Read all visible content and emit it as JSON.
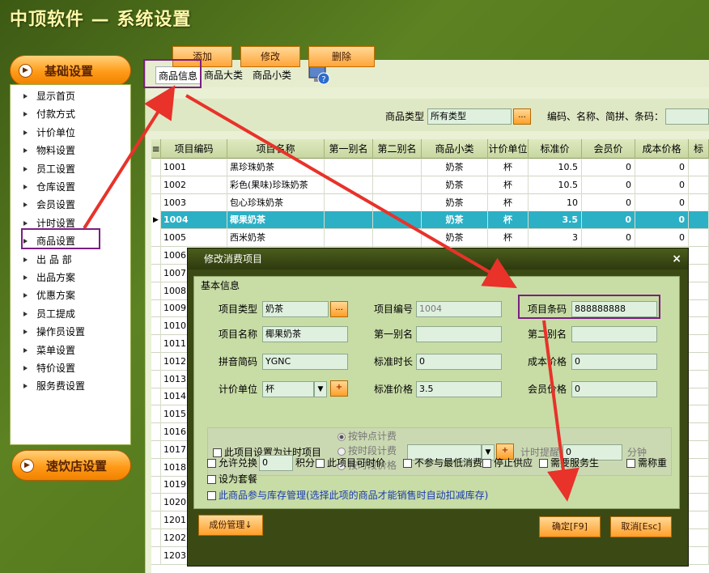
{
  "window": {
    "title": "中顶软件 — 系统设置"
  },
  "sidebar": {
    "basic_label": "基础设置",
    "fastfood_label": "速饮店设置",
    "items": [
      "显示首页",
      "付款方式",
      "计价单位",
      "物料设置",
      "员工设置",
      "仓库设置",
      "会员设置",
      "计时设置",
      "商品设置",
      "出 品 部",
      "出品方案",
      "优惠方案",
      "员工提成",
      "操作员设置",
      "菜单设置",
      "特价设置",
      "服务费设置"
    ]
  },
  "tabs": {
    "items": [
      "商品信息",
      "商品大类",
      "商品小类"
    ],
    "help_icon": "help-monitor-icon"
  },
  "toolbar": {
    "add": "添加",
    "edit": "修改",
    "delete": "删除",
    "type_label": "商品类型",
    "type_value": "所有类型",
    "dots": "...",
    "search_label": "编码、名称、简拼、条码："
  },
  "table": {
    "columns": [
      "项目编码",
      "项目名称",
      "第一别名",
      "第二别名",
      "商品小类",
      "计价单位",
      "标准价",
      "会员价",
      "成本价格",
      "标"
    ],
    "rows": [
      [
        "1001",
        "黑珍珠奶茶",
        "",
        "",
        "奶茶",
        "杯",
        "10.5",
        "0",
        "0"
      ],
      [
        "1002",
        "彩色(果味)珍珠奶茶",
        "",
        "",
        "奶茶",
        "杯",
        "10.5",
        "0",
        "0"
      ],
      [
        "1003",
        "包心珍珠奶茶",
        "",
        "",
        "奶茶",
        "杯",
        "10",
        "0",
        "0"
      ],
      [
        "1004",
        "椰果奶茶",
        "",
        "",
        "奶茶",
        "杯",
        "3.5",
        "0",
        "0"
      ],
      [
        "1005",
        "西米奶茶",
        "",
        "",
        "奶茶",
        "杯",
        "3",
        "0",
        "0"
      ]
    ],
    "extra_codes": [
      "1006",
      "1007",
      "1008",
      "1009",
      "1010",
      "1011",
      "1012",
      "1013",
      "1014",
      "1015",
      "1016",
      "1017",
      "1018",
      "1019",
      "1020",
      "1201",
      "1202",
      "1203"
    ],
    "selected_index": 3
  },
  "dialog": {
    "title": "修改消费项目",
    "close": "×",
    "group_title": "基本信息",
    "labels": {
      "type": "项目类型",
      "code": "项目编号",
      "barcode": "项目条码",
      "name": "项目名称",
      "alias1": "第一别名",
      "alias2": "第二别名",
      "pinyin": "拼音简码",
      "std_time": "标准时长",
      "cost": "成本价格",
      "unit": "计价单位",
      "std_price": "标准价格",
      "member_price": "会员价格",
      "timed_item": "此项目设置为计时项目",
      "by_clock": "按钟点计费",
      "by_period": "按时段计费",
      "by_period_price": "按时段价格",
      "timer_remind": "计时提醒",
      "minutes": "分钟",
      "allow_redeem": "允许兑换",
      "points": "积分",
      "timeable": "此项目可时价",
      "no_min_spend": "不参与最低消费",
      "stop_supply": "停止供应",
      "need_waiter": "需要服务生",
      "need_weigh": "需称重",
      "set_meal": "设为套餐",
      "stock_manage": "此商品参与库存管理(选择此项的商品才能销售时自动扣减库存)"
    },
    "values": {
      "type": "奶茶",
      "code": "1004",
      "barcode": "888888888",
      "name": "椰果奶茶",
      "alias1": "",
      "alias2": "",
      "pinyin": "YGNC",
      "std_time": "0",
      "cost": "0",
      "unit": "杯",
      "std_price": "3.5",
      "member_price": "0",
      "remind": "0",
      "points": "0"
    },
    "buttons": {
      "components": "成份管理↓",
      "ok": "确定[F9]",
      "cancel": "取消[Esc]",
      "dots": "...",
      "plus": "+"
    }
  },
  "colors": {
    "accent_orange": "#ff9a18",
    "selection": "#2bb0c6",
    "highlight": "#7a1f82",
    "arrow": "#e8322a"
  }
}
